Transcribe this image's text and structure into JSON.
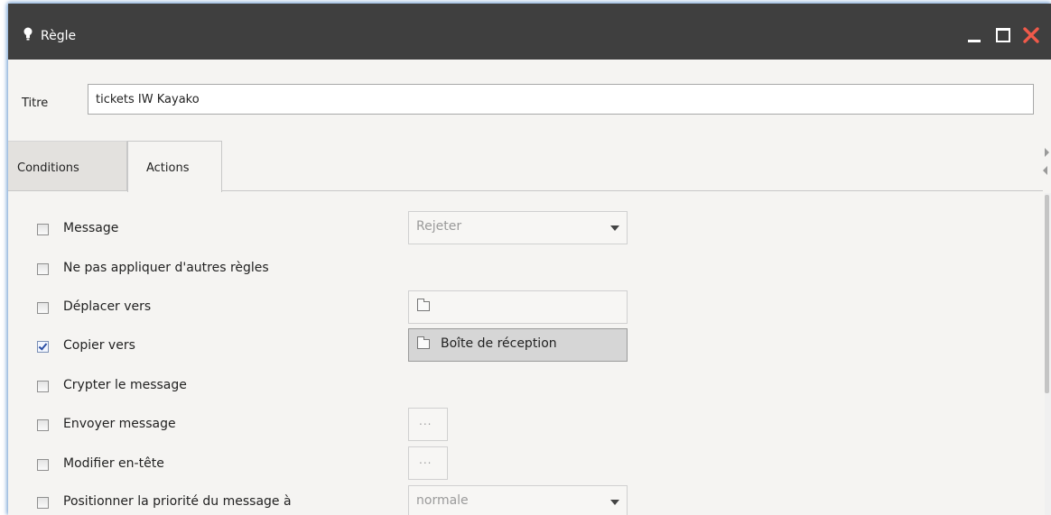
{
  "window": {
    "title": "Règle",
    "title_icon": "lightbulb-icon",
    "controls": {
      "minimize": "minimize-icon",
      "maximize": "maximize-icon",
      "close": "close-icon"
    },
    "close_color": "#f05a4a"
  },
  "titre": {
    "label": "Titre",
    "value": "tickets IW Kayako"
  },
  "tabs": [
    {
      "label": "Conditions",
      "active": false
    },
    {
      "label": "Actions",
      "active": true
    }
  ],
  "actions": [
    {
      "label": "Message",
      "checked": false,
      "control": {
        "type": "select",
        "value": "Rejeter"
      }
    },
    {
      "label": "Ne pas appliquer d'autres règles",
      "checked": false
    },
    {
      "label": "Déplacer vers",
      "checked": false,
      "control": {
        "type": "folder",
        "value": ""
      }
    },
    {
      "label": "Copier vers",
      "checked": true,
      "control": {
        "type": "folder",
        "value": "Boîte de réception"
      }
    },
    {
      "label": "Crypter le message",
      "checked": false
    },
    {
      "label": "Envoyer message",
      "checked": false,
      "control": {
        "type": "button",
        "value": "..."
      }
    },
    {
      "label": "Modifier en-tête",
      "checked": false,
      "control": {
        "type": "button",
        "value": "..."
      }
    },
    {
      "label": "Positionner la priorité du message à",
      "checked": false,
      "control": {
        "type": "select",
        "value": "normale"
      }
    }
  ],
  "colors": {
    "titlebar": "#3f3f3f",
    "panel": "#f5f4f2",
    "checkbox_check": "#2b4fa5"
  }
}
